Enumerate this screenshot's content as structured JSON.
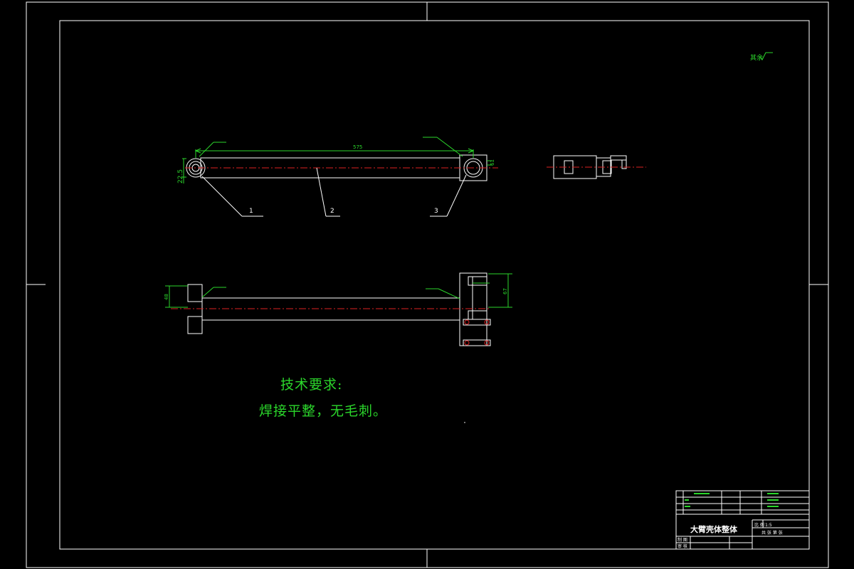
{
  "drawing": {
    "roughness_note": "其余",
    "dimensions": {
      "top_length": "575",
      "left_dia": "22.5",
      "right_height": "61",
      "front_left_height": "48",
      "right_box_height": "67"
    },
    "balloons": [
      "1",
      "2",
      "3"
    ]
  },
  "notes": {
    "heading": "技术要求:",
    "line1": "焊接平整，无毛刺。"
  },
  "title_block": {
    "title": "大臂壳体整体",
    "scale_label": "比 例",
    "scale_value": "1:5",
    "sheet_label": "共 张 第 张",
    "designer_label": "制 图",
    "checker_label": "审 核"
  }
}
